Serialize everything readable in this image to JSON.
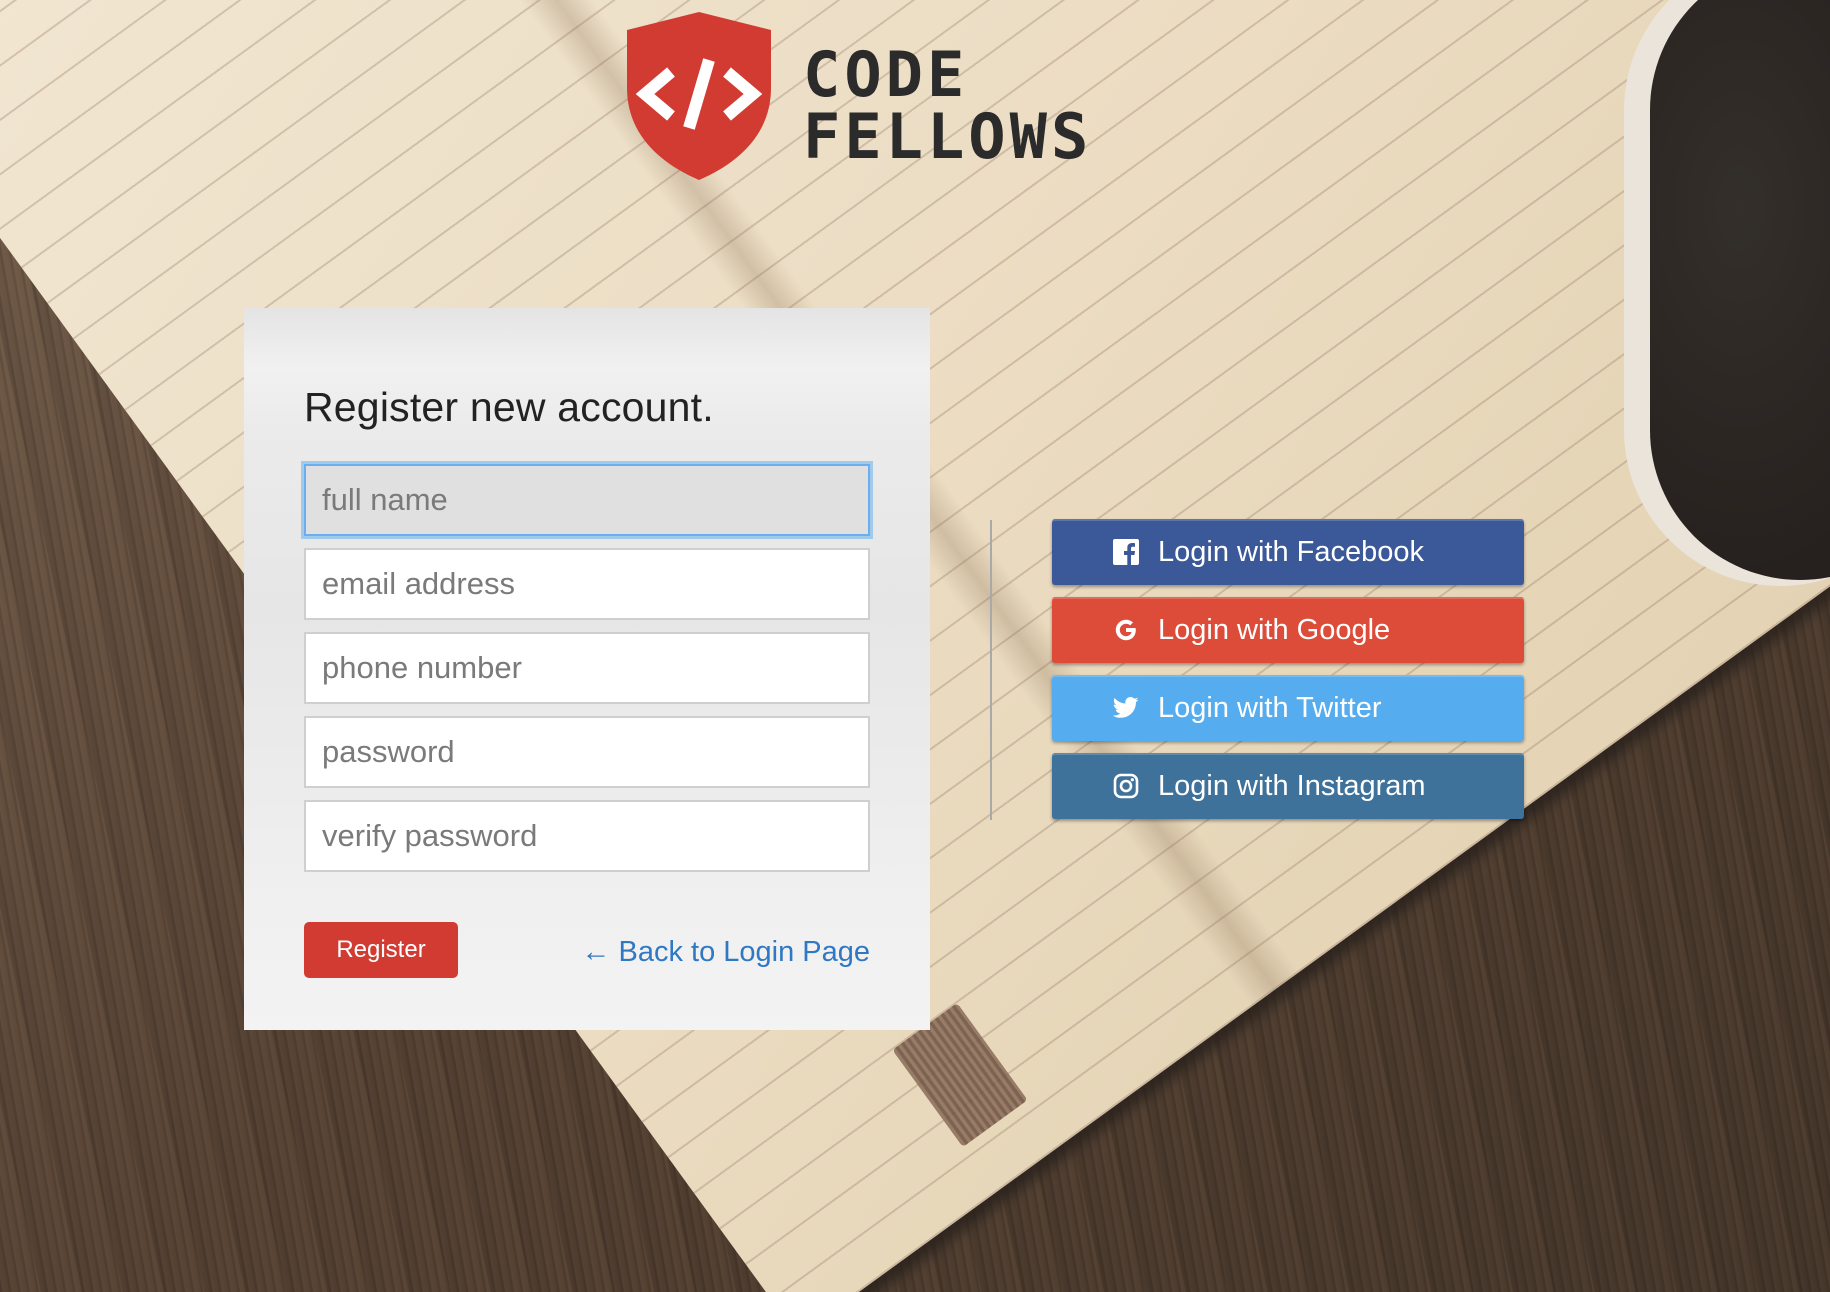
{
  "logo": {
    "line1": "CODE",
    "line2": "FELLOWS",
    "icon": "code-shield-icon"
  },
  "register": {
    "title": "Register new account.",
    "fields": {
      "full_name": "full name",
      "email": "email address",
      "phone": "phone number",
      "password": "password",
      "verify_password": "verify password"
    },
    "register_label": "Register",
    "back_link": "← Back to Login Page"
  },
  "social": {
    "facebook": {
      "label": "Login with Facebook",
      "icon": "facebook-icon",
      "color": "#3b5998"
    },
    "google": {
      "label": "Login with Google",
      "icon": "google-icon",
      "color": "#dd4b39"
    },
    "twitter": {
      "label": "Login with Twitter",
      "icon": "twitter-icon",
      "color": "#55acee"
    },
    "instagram": {
      "label": "Login with Instagram",
      "icon": "instagram-icon",
      "color": "#3f729b"
    }
  },
  "colors": {
    "brand_red": "#d13b32",
    "link_blue": "#2f78c4",
    "focus_blue": "#6aaef0"
  }
}
